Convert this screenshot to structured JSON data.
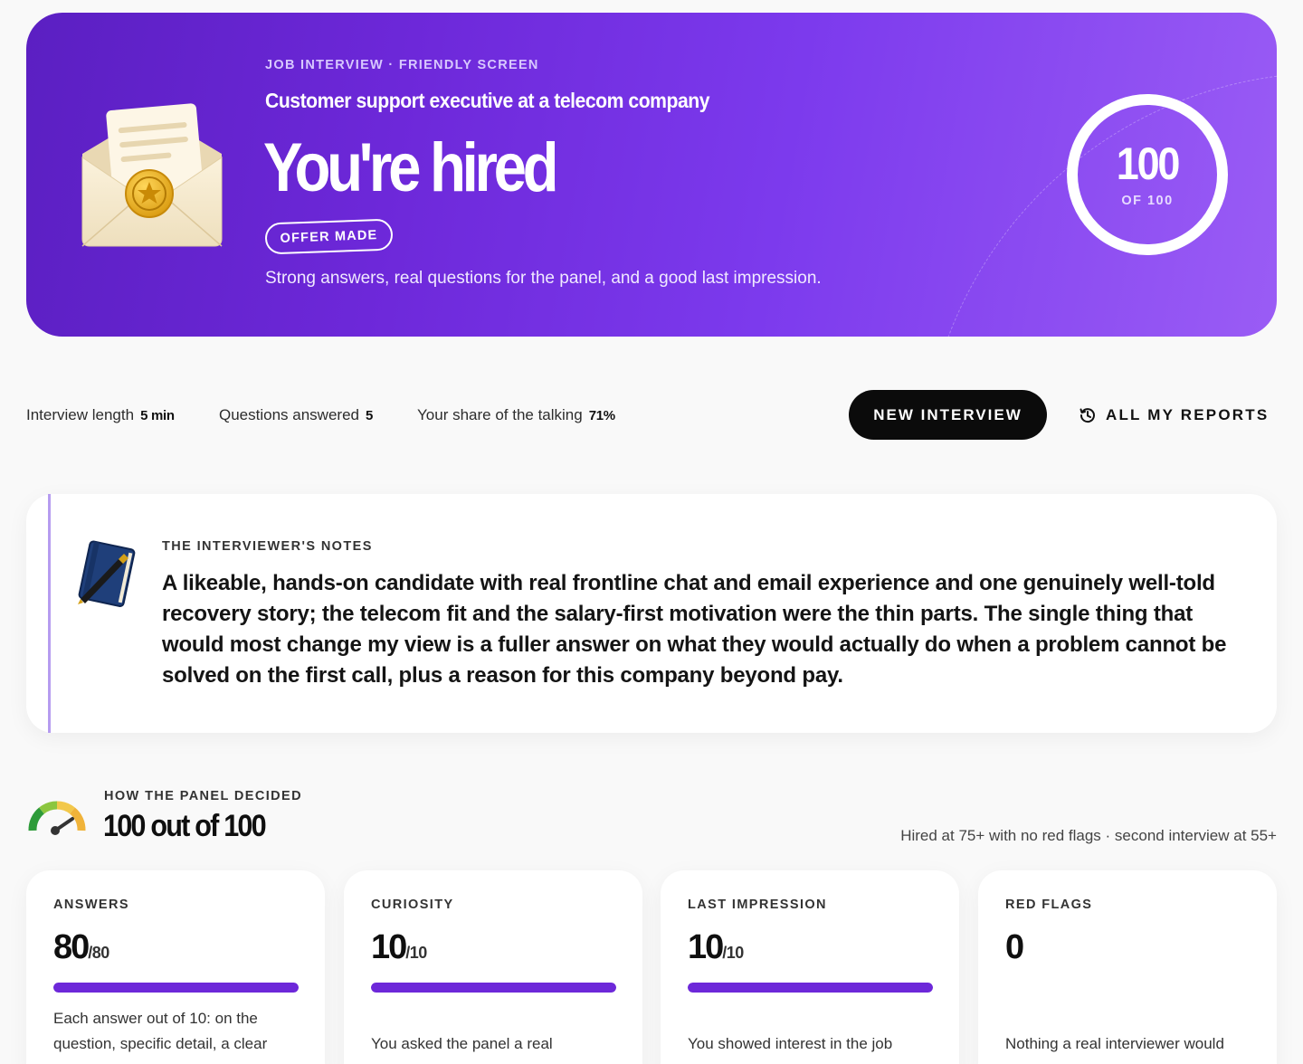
{
  "hero": {
    "eyebrow": "JOB INTERVIEW · FRIENDLY SCREEN",
    "role": "Customer support executive at a telecom company",
    "verdict": "You're hired",
    "badge": "OFFER MADE",
    "summary": "Strong answers, real questions for the panel, and a good last impression.",
    "score": "100",
    "score_of": "OF 100",
    "icon": "envelope-seal-icon"
  },
  "stats": [
    {
      "label": "Interview length",
      "value": "5 min"
    },
    {
      "label": "Questions answered",
      "value": "5"
    },
    {
      "label": "Your share of the talking",
      "value": "71%"
    }
  ],
  "actions": {
    "new_interview": "NEW INTERVIEW",
    "all_reports": "ALL MY REPORTS",
    "reports_icon": "history-icon"
  },
  "notes": {
    "label": "THE INTERVIEWER'S NOTES",
    "text": "A likeable, hands-on candidate with real frontline chat and email experience and one genuinely well-told recovery story; the telecom fit and the salary-first motivation were the thin parts. The single thing that would most change my view is a fuller answer on what they would actually do when a problem cannot be solved on the first call, plus a reason for this company beyond pay.",
    "icon": "notebook-pen-icon"
  },
  "panel": {
    "label": "HOW THE PANEL DECIDED",
    "score": "100 out of 100",
    "rule": "Hired at 75+ with no red flags · second interview at 55+",
    "icon": "gauge-icon"
  },
  "cards": [
    {
      "label": "ANSWERS",
      "value": "80",
      "max": "/80",
      "fill": 1.0,
      "desc": "Each answer out of 10: on the question, specific detail, a clear"
    },
    {
      "label": "CURIOSITY",
      "value": "10",
      "max": "/10",
      "fill": 1.0,
      "desc": "You asked the panel a real"
    },
    {
      "label": "LAST IMPRESSION",
      "value": "10",
      "max": "/10",
      "fill": 1.0,
      "desc": "You showed interest in the job"
    },
    {
      "label": "RED FLAGS",
      "value": "0",
      "max": "",
      "desc": "Nothing a real interviewer would"
    }
  ],
  "colors": {
    "hero_start": "#5b1fc2",
    "hero_end": "#9a5cf5",
    "accent": "#6d28d9",
    "button": "#0b0b0b"
  }
}
